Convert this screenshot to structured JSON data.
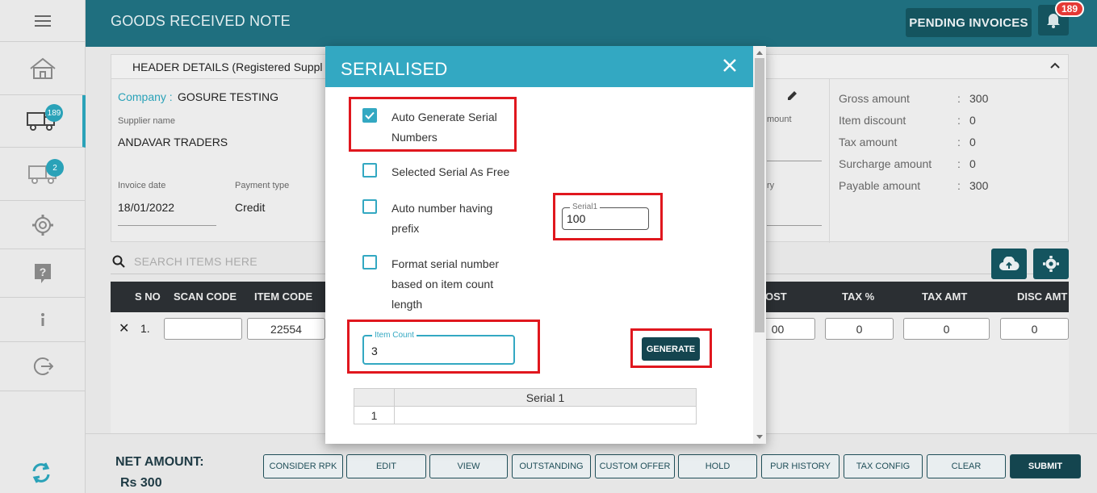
{
  "nav": {
    "truck_badge": "189",
    "truck2_badge": "2"
  },
  "topbar": {
    "title": "GOODS RECEIVED NOTE",
    "pending_invoices": "PENDING INVOICES",
    "notification_count": "189"
  },
  "header_card": {
    "title": "HEADER DETAILS (Registered Suppl",
    "company_label": "Company :",
    "company_value": "GOSURE TESTING",
    "supplier_label": "Supplier name",
    "supplier_value": "ANDAVAR TRADERS",
    "invoice_date_label": "Invoice date",
    "invoice_date_value": "18/01/2022",
    "payment_type_label": "Payment type",
    "payment_type_value": "Credit",
    "partial_amount_label": "mount",
    "partial_ry_label": "ry"
  },
  "totals": [
    {
      "label": "Gross amount",
      "value": "300"
    },
    {
      "label": "Item discount",
      "value": "0"
    },
    {
      "label": "Tax amount",
      "value": "0"
    },
    {
      "label": "Surcharge amount",
      "value": "0"
    },
    {
      "label": "Payable amount",
      "value": "300"
    }
  ],
  "totals_separator": ":",
  "search": {
    "placeholder": "SEARCH ITEMS HERE"
  },
  "table": {
    "headers": {
      "sno": "S NO",
      "scan_code": "SCAN CODE",
      "item_code": "ITEM CODE",
      "cost": "OST",
      "tax_pct": "TAX %",
      "tax_amt": "TAX AMT",
      "disc_amt": "DISC AMT"
    },
    "row": {
      "delete": "✕",
      "sno": "1.",
      "scan_code": "",
      "item_code": "22554",
      "cost": "00",
      "tax_pct": "0",
      "tax_amt": "0",
      "disc_amt": "0"
    }
  },
  "bottom": {
    "net_label": "NET AMOUNT:",
    "net_value": "Rs 300",
    "buttons": [
      "CONSIDER RPK",
      "EDIT",
      "VIEW",
      "OUTSTANDING",
      "CUSTOM OFFER",
      "HOLD",
      "PUR HISTORY",
      "TAX CONFIG",
      "CLEAR",
      "SUBMIT"
    ]
  },
  "modal": {
    "title": "SERIALISED",
    "options": [
      {
        "line1": "Auto Generate Serial",
        "line2": "Numbers",
        "checked": true
      },
      {
        "line1": "Selected Serial As Free",
        "checked": false
      },
      {
        "line1": "Auto number having",
        "line2": "prefix",
        "checked": false
      },
      {
        "line1": "Format serial number",
        "line2": "based on item count",
        "line3": "length",
        "checked": false
      }
    ],
    "serial1_label": "Serial1",
    "serial1_value": "100",
    "item_count_label": "Item Count",
    "item_count_value": "3",
    "generate": "GENERATE",
    "grid_header": "Serial 1",
    "grid_rows": [
      {
        "index": "1",
        "value": ""
      }
    ]
  },
  "colors": {
    "teal_dark": "#1f6f7f",
    "modal_head": "#33a8c2",
    "highlight_red": "#e0171e",
    "button_dark": "#14454f"
  }
}
